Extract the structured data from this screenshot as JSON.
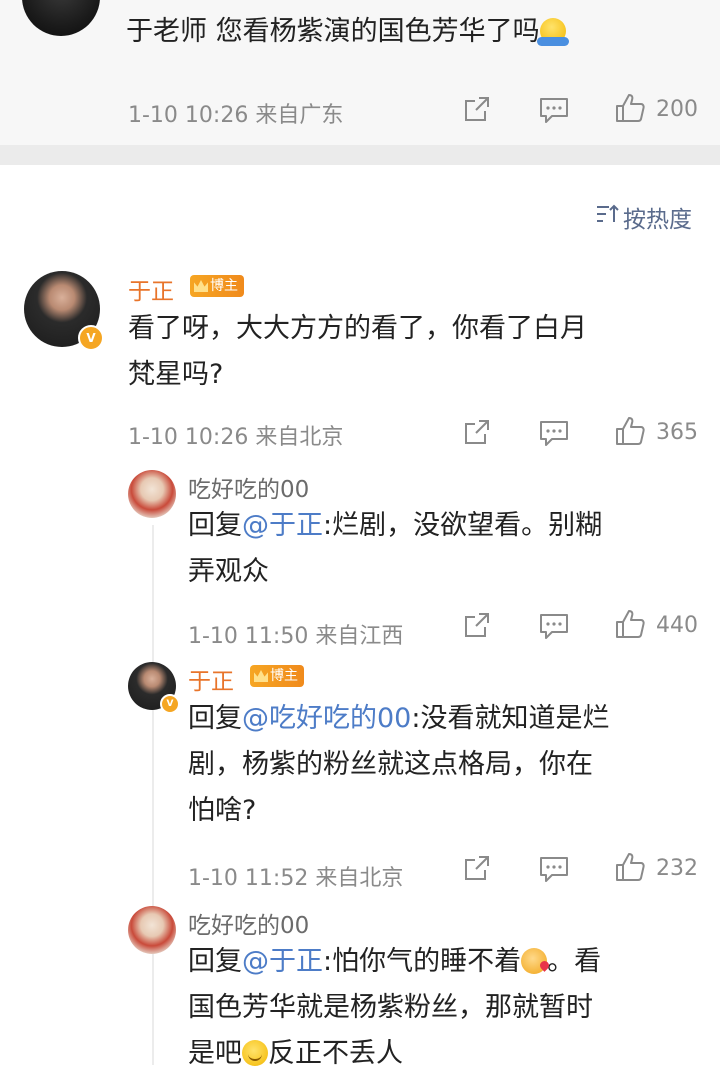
{
  "top_comment": {
    "text": "于老师 您看杨紫演的国色芳华了吗",
    "emoji": "hug-emoji",
    "time": "1-10 10:26",
    "location": "来自广东",
    "likes": "200"
  },
  "sort": {
    "label": "按热度",
    "icon": "sort-icon"
  },
  "main_comment": {
    "author": "于正",
    "badge": "博主",
    "text": "看了呀，大大方方的看了，你看了白月梵星吗?",
    "line1": "看了呀，大大方方的看了，你看了白月",
    "line2": "梵星吗?",
    "time": "1-10 10:26",
    "location": "来自北京",
    "likes": "365",
    "verified_icon": "v-badge-icon"
  },
  "replies": [
    {
      "author": "吃好吃的00",
      "reply_prefix": "回复",
      "mention": "@于正",
      "line1_rest": ":烂剧，没欲望看。别糊",
      "line2": "弄观众",
      "time": "1-10 11:50",
      "location": "来自江西",
      "likes": "440"
    },
    {
      "author": "于正",
      "badge": "博主",
      "reply_prefix": "回复",
      "mention": "@吃好吃的00",
      "line1_rest": ":没看就知道是烂",
      "line2": "剧，杨紫的粉丝就这点格局，你在",
      "line3": "怕啥?",
      "time": "1-10 11:52",
      "location": "来自北京",
      "likes": "232"
    },
    {
      "author": "吃好吃的00",
      "reply_prefix": "回复",
      "mention": "@于正",
      "line1_rest": ":怕你气的睡不着",
      "line1_end": "。看",
      "line2": "国色芳华就是杨紫粉丝，那就暂时",
      "line3_start": "是吧",
      "line3_end": "反正不丢人",
      "emoji1": "kiss-emoji",
      "emoji2": "smile-emoji"
    }
  ],
  "colors": {
    "accent_name": "#e8742a",
    "mention": "#4d7cc7",
    "meta_gray": "#8a8a8a",
    "sort_blue": "#5a6b8c",
    "badge_orange": "#f6a623"
  }
}
